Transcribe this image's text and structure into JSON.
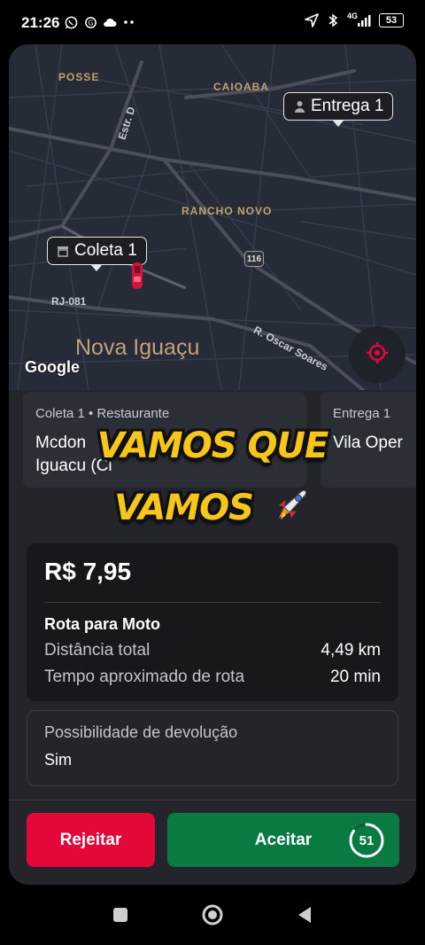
{
  "status_bar": {
    "time": "21:26",
    "network": "4G",
    "battery": "53",
    "icons": [
      "whatsapp-icon",
      "sync-icon",
      "cloud-icon",
      "more-icon",
      "location-arrow-icon",
      "bluetooth-icon",
      "signal-icon",
      "battery-icon"
    ]
  },
  "map": {
    "neighborhoods": [
      "POSSE",
      "CAIOABA",
      "RANCHO NOVO"
    ],
    "roads": [
      "Estr. D",
      "RJ-081",
      "R. Oscar Soares"
    ],
    "highway_shield": "116",
    "city": "Nova Iguaçu",
    "attribution": "Google",
    "pickup_marker": "Coleta 1",
    "dropoff_marker": "Entrega 1",
    "accent_color": "#e4073a"
  },
  "stops": {
    "pickup": {
      "title": "Coleta 1 • Restaurante",
      "name_line1": "Mcdon",
      "name_line2": "Iguacu (Ci"
    },
    "dropoff": {
      "title": "Entrega 1",
      "name": "Vila Oper"
    }
  },
  "overlay": {
    "line1": "VAMOS QUE",
    "line2": "VAMOS"
  },
  "offer": {
    "price": "R$ 7,95",
    "route_title": "Rota para Moto",
    "distance_label": "Distância total",
    "distance_value": "4,49 km",
    "time_label": "Tempo aproximado de rota",
    "time_value": "20 min"
  },
  "return_info": {
    "label": "Possibilidade de devolução",
    "value": "Sim"
  },
  "actions": {
    "reject_label": "Rejeitar",
    "accept_label": "Aceitar",
    "timer_seconds": "51",
    "timer_progress": 0.85,
    "reject_color": "#e4073a",
    "accept_color": "#0a7a43"
  }
}
